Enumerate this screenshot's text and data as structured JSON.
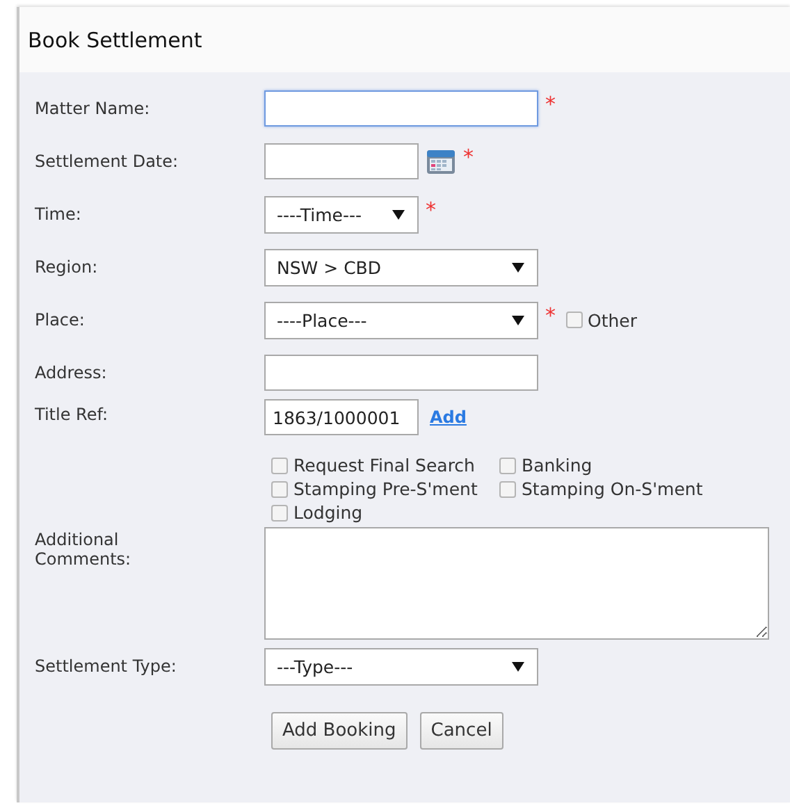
{
  "title": "Book Settlement",
  "fields": [
    {
      "kind": "text",
      "label": "Matter Name:",
      "focused": true,
      "required_mark": "*"
    },
    {
      "kind": "date",
      "label": "Settlement Date:",
      "required_mark": "*"
    },
    {
      "kind": "short_select",
      "label": "Time:",
      "value": "----Time---",
      "required_mark": "*"
    },
    {
      "kind": "select",
      "label": "Region:",
      "value": "NSW > CBD"
    },
    {
      "kind": "select",
      "label": "Place:",
      "value": "----Place---",
      "required_mark": "*",
      "other": {
        "label": "Other",
        "checked": false
      }
    },
    {
      "kind": "text",
      "label": "Address:",
      "focused": false
    },
    {
      "kind": "ref",
      "label": "Title Ref:",
      "value": "1863/1000001",
      "link": "Add"
    },
    {
      "kind": "checks",
      "options": [
        {
          "label": "Request Final Search",
          "checked": false
        },
        {
          "label": "Banking",
          "checked": false
        },
        {
          "label": "Stamping Pre-S'ment",
          "checked": false
        },
        {
          "label": "Stamping On-S'ment",
          "checked": false
        },
        {
          "label": "Lodging",
          "checked": false
        }
      ]
    },
    {
      "kind": "textarea",
      "label": "Additional Comments:"
    },
    {
      "kind": "select",
      "label": "Settlement Type:",
      "value": "---Type---"
    }
  ],
  "buttons": [
    "Add Booking",
    "Cancel"
  ]
}
